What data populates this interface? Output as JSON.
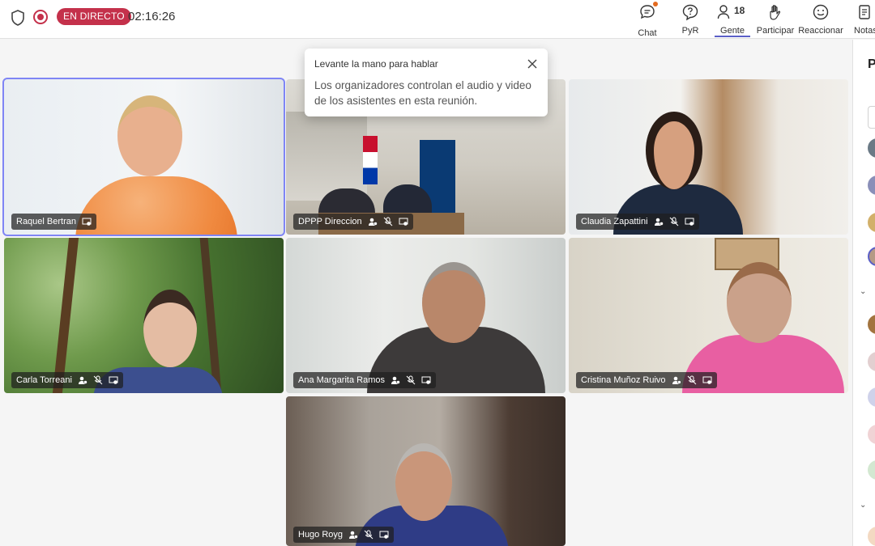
{
  "status": {
    "live_label": "EN DIRECTO",
    "timer": "02:16:26"
  },
  "toolbar": {
    "chat_label": "Chat",
    "qa_label": "PyR",
    "people_label": "Gente",
    "people_count": "18",
    "raise_label": "Participar",
    "react_label": "Reaccionar",
    "notes_label": "Notas"
  },
  "tooltip": {
    "title": "Levante la mano para hablar",
    "body": "Los organizadores controlan el audio y video de los asistentes en esta reunión."
  },
  "participants": [
    {
      "name": "Raquel Bertran"
    },
    {
      "name": "DPPP Direccion"
    },
    {
      "name": "Claudia Zapattini"
    },
    {
      "name": "Carla Torreani"
    },
    {
      "name": "Ana Margarita Ramos"
    },
    {
      "name": "Cristina Muñoz Ruivo"
    },
    {
      "name": "Hugo Royg"
    }
  ],
  "right_panel": {
    "title_initial": "P"
  },
  "colors": {
    "accent": "#5b5fc7",
    "live": "#c4314b",
    "speaker_outline": "#7f85f5"
  }
}
